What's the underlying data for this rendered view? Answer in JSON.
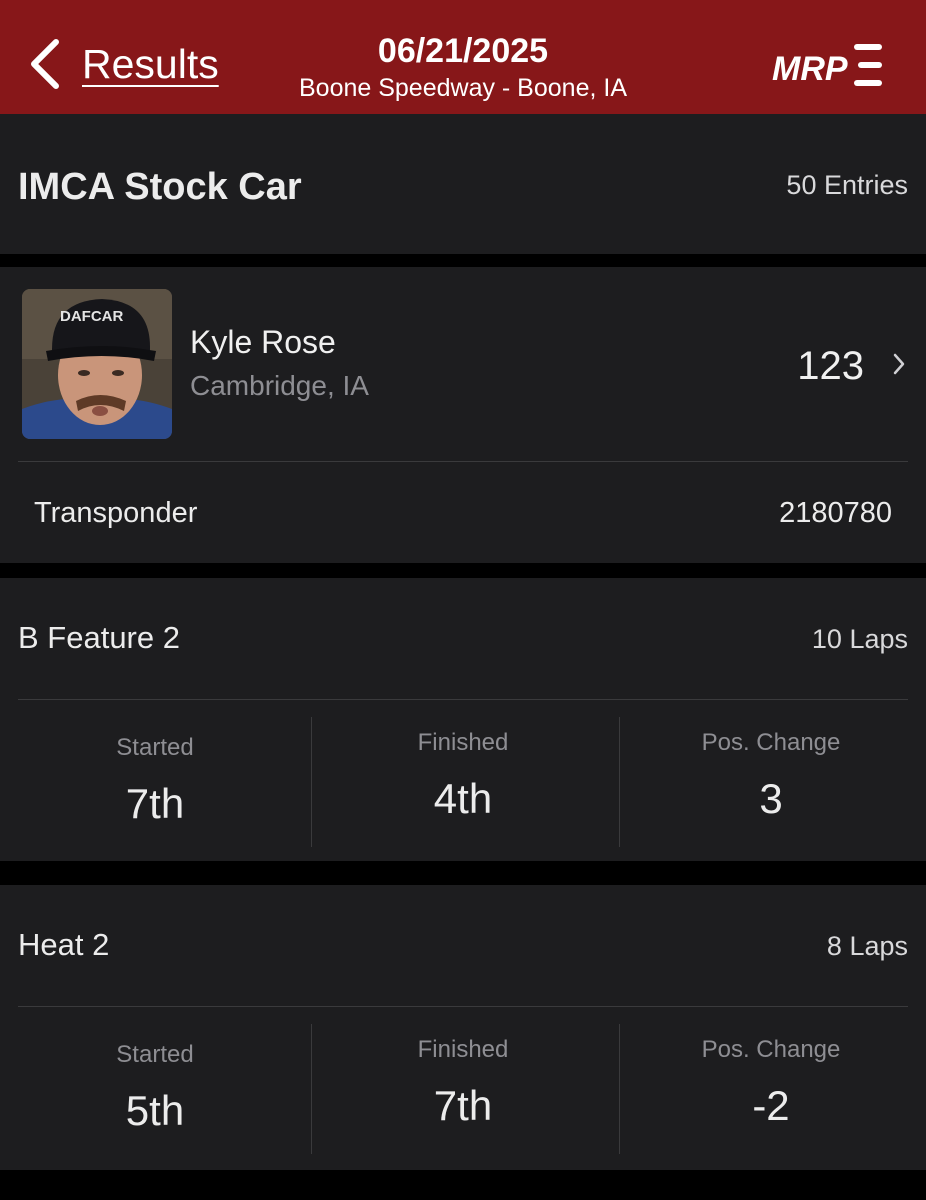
{
  "header": {
    "back_label": "Results",
    "date": "06/21/2025",
    "venue": "Boone Speedway - Boone, IA",
    "logo_text": "MRP"
  },
  "class_info": {
    "name": "IMCA Stock Car",
    "entries": "50 Entries"
  },
  "driver": {
    "name": "Kyle Rose",
    "hometown": "Cambridge, IA",
    "car_number": "123",
    "hat_text": "DAFCAR",
    "transponder_label": "Transponder",
    "transponder_value": "2180780"
  },
  "races": [
    {
      "name": "B Feature 2",
      "laps": "10 Laps",
      "started_label": "Started",
      "started": "7th",
      "finished_label": "Finished",
      "finished": "4th",
      "pos_change_label": "Pos. Change",
      "pos_change": "3"
    },
    {
      "name": "Heat 2",
      "laps": "8 Laps",
      "started_label": "Started",
      "started": "5th",
      "finished_label": "Finished",
      "finished": "7th",
      "pos_change_label": "Pos. Change",
      "pos_change": "-2"
    }
  ],
  "colors": {
    "header_bg": "#871719",
    "card_bg": "#1d1d1f",
    "page_bg": "#000000",
    "secondary_text": "#8e8e93"
  }
}
